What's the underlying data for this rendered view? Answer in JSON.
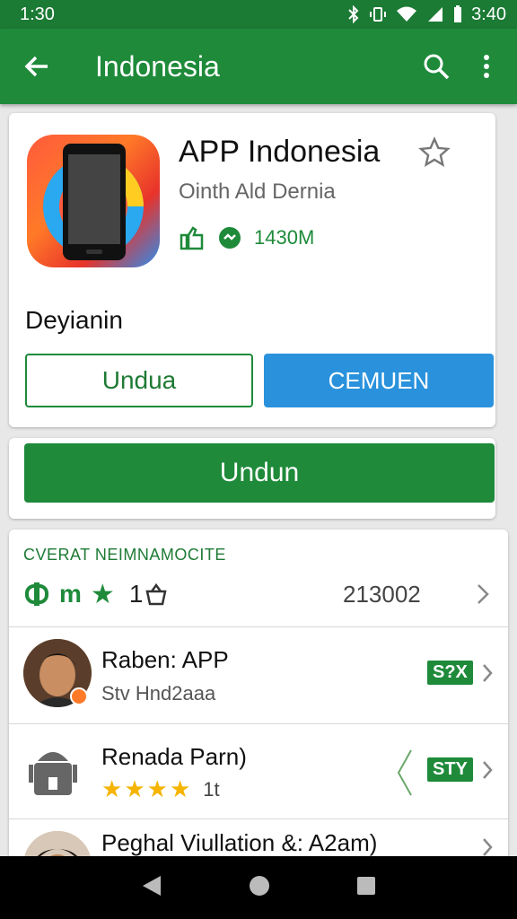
{
  "status_bar": {
    "time": "1:30",
    "clock": "3:40"
  },
  "app_bar": {
    "title": "Indonesia"
  },
  "app": {
    "name": "APP Indonesia",
    "developer": "Ointh Ald Dernia",
    "downloads": "1430M",
    "section_label": "Deyianin",
    "btn_outline": "Undua",
    "btn_blue": "CEMUEN"
  },
  "install": {
    "label": "Undun"
  },
  "list": {
    "header": "CVERAT NEIMNAMOCITE",
    "summary": {
      "icons": "m",
      "count": "1",
      "number": "213002"
    },
    "rows": [
      {
        "title": "Raben: APP",
        "subtitle": "Stv Hnd2aaa",
        "badge": "S?X"
      },
      {
        "title": "Renada Parn)",
        "rating": "1t",
        "badge": "STY"
      },
      {
        "title": "Peghal Viullation &: A2am)"
      }
    ]
  },
  "colors": {
    "primary": "#1e8a3a",
    "accent": "#2a92dc",
    "star": "#f5b400"
  }
}
